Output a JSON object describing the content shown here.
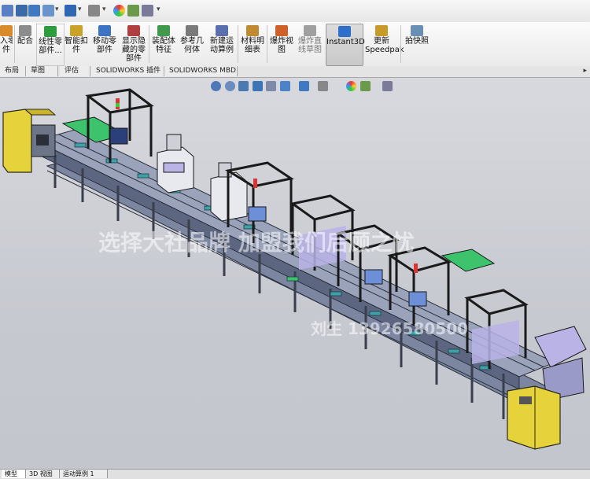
{
  "ribbon": {
    "buttons": [
      {
        "label": "入零\n件",
        "icon": "insert-components-icon",
        "color": "#d98a2b"
      },
      {
        "label": "配合",
        "icon": "mate-icon",
        "color": "#8c8c8c"
      },
      {
        "label": "线性零\n部件...",
        "icon": "linear-pattern-icon",
        "color": "#2d9c3c"
      },
      {
        "label": "智能扣\n件",
        "icon": "smart-fasteners-icon",
        "color": "#c9a227"
      },
      {
        "label": "移动零\n部件",
        "icon": "move-component-icon",
        "color": "#3b74c4"
      },
      {
        "label": "显示隐\n藏的零\n部件",
        "icon": "show-hidden-icon",
        "color": "#b04040"
      },
      {
        "label": "装配体\n特征",
        "icon": "assembly-features-icon",
        "color": "#3f9a4a"
      },
      {
        "label": "参考几\n何体",
        "icon": "reference-geometry-icon",
        "color": "#7a7a7a"
      },
      {
        "label": "新建运\n动算例",
        "icon": "new-motion-study-icon",
        "color": "#5a6fb0"
      },
      {
        "label": "材料明\n细表",
        "icon": "bom-icon",
        "color": "#c28a30"
      },
      {
        "label": "爆炸视\n图",
        "icon": "exploded-view-icon",
        "color": "#d0602a"
      },
      {
        "label": "爆炸直\n线草图",
        "icon": "explode-line-sketch-icon",
        "color": "#a0a0a0"
      },
      {
        "label": "Instant3D",
        "icon": "instant3d-icon",
        "color": "#2e6fc9"
      },
      {
        "label": "更新\nSpeedpak",
        "icon": "speedpak-icon",
        "color": "#c79a2a"
      },
      {
        "label": "拍快照",
        "icon": "snapshot-icon",
        "color": "#6a8fb5"
      }
    ]
  },
  "tabs": [
    "布局",
    "草图",
    "评估",
    "SOLIDWORKS 插件",
    "SOLIDWORKS MBD"
  ],
  "bottom_tabs": [
    "模型",
    "3D 视图",
    "运动算例 1"
  ],
  "watermarks": {
    "line1": "选择大社品牌 加盟我们后顾之忧",
    "line2": "刘生 13926580500"
  },
  "colors": {
    "frame": "#4a5ea8",
    "frame_dark": "#1a1a1a",
    "conveyor_top": "#9aa3ba",
    "conveyor_side": "#5d6680",
    "green_table": "#3dc36b",
    "yellow_cabinet": "#e6d23a",
    "lavender_panel": "#b9b3e6",
    "machine_white": "#e8e8ef"
  }
}
